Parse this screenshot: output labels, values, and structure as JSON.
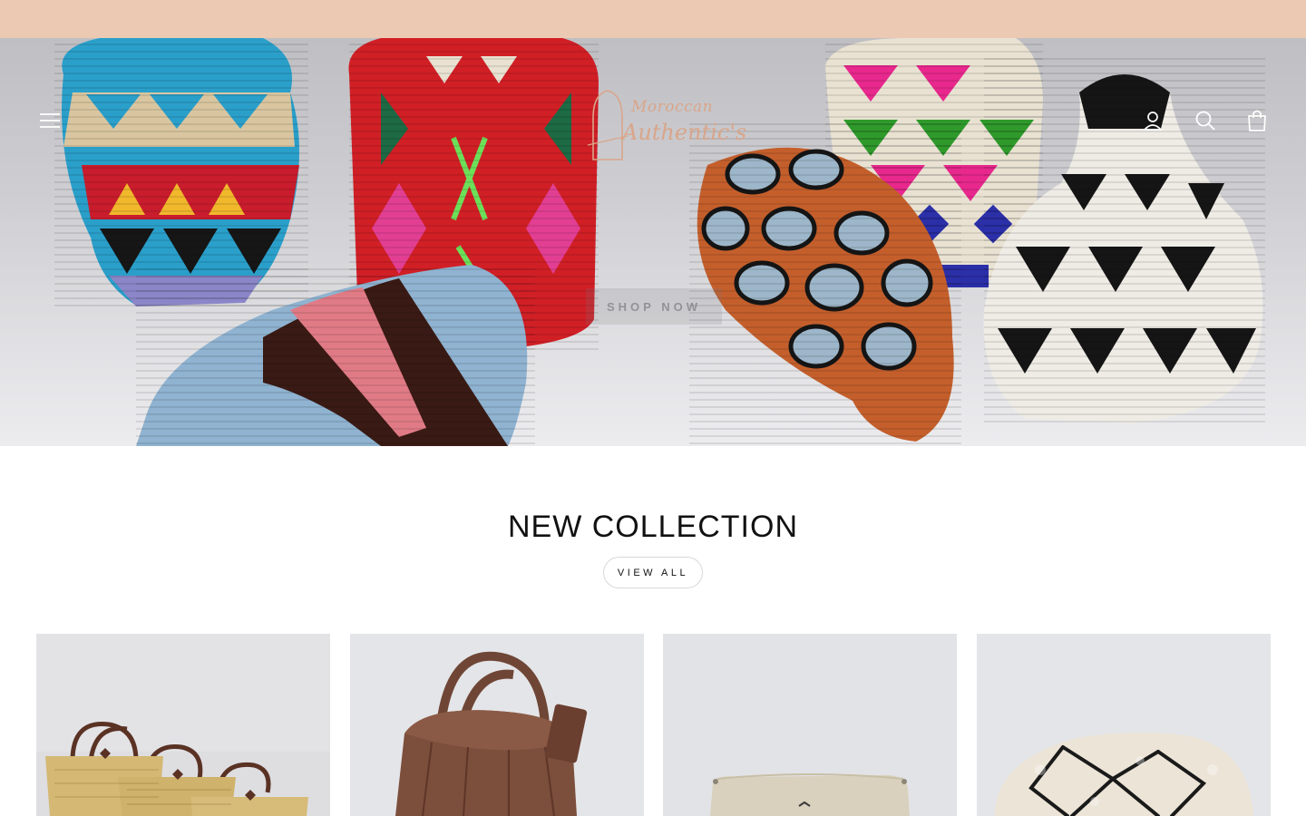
{
  "announcement": {
    "text": "",
    "background": "#ecc9b2"
  },
  "header": {
    "icons": [
      "menu-icon",
      "account-icon",
      "search-icon",
      "cart-icon"
    ]
  },
  "logo": {
    "line1": "Moroccan",
    "line2": "Authentic's",
    "color": "#d9a58a"
  },
  "hero": {
    "cta_label": "SHOP NOW"
  },
  "collection": {
    "title": "NEW COLLECTION",
    "view_all_label": "VIEW ALL"
  },
  "products": [
    {
      "image": "straw-baskets-with-leather-handles"
    },
    {
      "image": "brown-leather-bucket-bag"
    },
    {
      "image": "beige-cushion"
    },
    {
      "image": "berber-pouf"
    }
  ]
}
